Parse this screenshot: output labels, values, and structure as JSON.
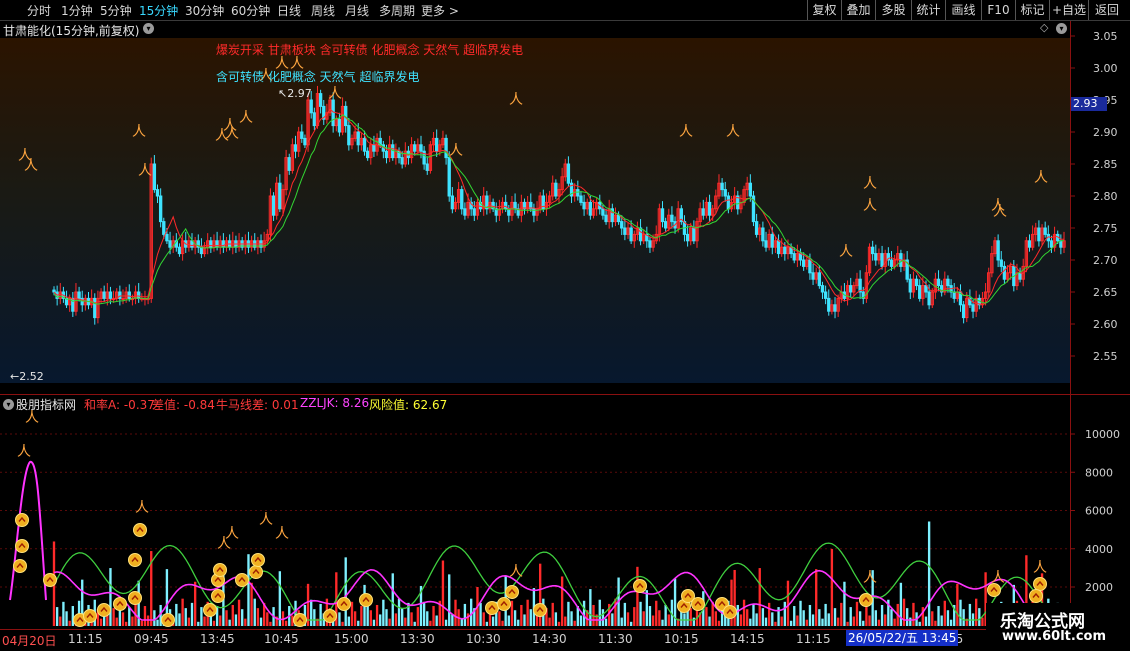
{
  "toolbar": {
    "periods": [
      "分时",
      "1分钟",
      "5分钟",
      "15分钟",
      "30分钟",
      "60分钟",
      "日线",
      "周线",
      "月线",
      "多周期",
      "更多 >"
    ],
    "active_period": "15分钟",
    "right_buttons": [
      "复权",
      "叠加",
      "多股",
      "统计",
      "画线",
      "F10",
      "标记",
      "+自选",
      "返回"
    ]
  },
  "main_chart": {
    "title": "甘肃能化(15分钟,前复权)",
    "news_line1": "爆炭开采 甘肃板块 含可转债 化肥概念 天然气 超临界发电",
    "news_line2": "含可转债 化肥概念 天然气 超临界发电",
    "y_ticks": [
      "3.05",
      "3.00",
      "2.95",
      "2.90",
      "2.85",
      "2.80",
      "2.75",
      "2.70",
      "2.65",
      "2.60",
      "2.55"
    ],
    "current_price": "2.93",
    "high_label": "2.97",
    "low_label": "2.52",
    "colors": {
      "up": "#ff2a2a",
      "down": "#3fe3ff",
      "ma_red": "#ff2a2a",
      "ma_green": "#33d633",
      "bg_top": "#2b1400",
      "bg_bottom": "#07182e"
    }
  },
  "indicator": {
    "name": "股朋指标网",
    "values": [
      {
        "text": "和率A: -0.37",
        "color": "#ff3a3a"
      },
      {
        "text": "差值: -0.84",
        "color": "#ff3a3a"
      },
      {
        "text": "牛马线差: 0.01",
        "color": "#ff3a3a"
      },
      {
        "text": "ZZLJK: 8.26",
        "color": "#ff44ff"
      },
      {
        "text": "风险值: 62.67",
        "color": "#ffff33"
      }
    ],
    "y_ticks": [
      "10000",
      "8000",
      "6000",
      "4000",
      "2000"
    ]
  },
  "time_axis": {
    "labels": [
      "04月20日",
      "11:15",
      "09:45",
      "13:45",
      "10:45",
      "15:00",
      "13:30",
      "10:30",
      "14:30",
      "11:30",
      "10:15",
      "14:15",
      "11:15",
      "13:45",
      "45"
    ],
    "cursor_time": "26/05/22/五 13:45"
  },
  "watermark": {
    "line1": "乐淘公式网",
    "line2": "www.60lt.com"
  },
  "chart_data": {
    "type": "candlestick",
    "title": "甘肃能化(15分钟,前复权)",
    "ylim": [
      2.52,
      3.07
    ],
    "close": [
      2.65,
      2.64,
      2.65,
      2.64,
      2.63,
      2.64,
      2.62,
      2.65,
      2.64,
      2.63,
      2.64,
      2.63,
      2.64,
      2.61,
      2.64,
      2.65,
      2.64,
      2.65,
      2.64,
      2.64,
      2.65,
      2.64,
      2.64,
      2.65,
      2.64,
      2.64,
      2.65,
      2.64,
      2.64,
      2.64,
      2.64,
      2.85,
      2.81,
      2.8,
      2.76,
      2.74,
      2.73,
      2.72,
      2.73,
      2.72,
      2.71,
      2.73,
      2.72,
      2.73,
      2.72,
      2.73,
      2.72,
      2.71,
      2.72,
      2.73,
      2.72,
      2.73,
      2.72,
      2.73,
      2.72,
      2.73,
      2.72,
      2.73,
      2.72,
      2.73,
      2.72,
      2.73,
      2.72,
      2.73,
      2.72,
      2.73,
      2.72,
      2.73,
      2.74,
      2.8,
      2.77,
      2.82,
      2.78,
      2.81,
      2.86,
      2.84,
      2.88,
      2.87,
      2.9,
      2.89,
      2.88,
      2.95,
      2.93,
      2.91,
      2.96,
      2.94,
      2.92,
      2.93,
      2.95,
      2.91,
      2.92,
      2.9,
      2.94,
      2.91,
      2.88,
      2.89,
      2.9,
      2.88,
      2.89,
      2.87,
      2.86,
      2.88,
      2.87,
      2.89,
      2.88,
      2.87,
      2.86,
      2.88,
      2.86,
      2.87,
      2.86,
      2.85,
      2.87,
      2.86,
      2.88,
      2.87,
      2.88,
      2.87,
      2.85,
      2.84,
      2.88,
      2.89,
      2.87,
      2.88,
      2.89,
      2.86,
      2.8,
      2.78,
      2.79,
      2.81,
      2.78,
      2.77,
      2.79,
      2.78,
      2.77,
      2.79,
      2.78,
      2.8,
      2.78,
      2.79,
      2.78,
      2.77,
      2.78,
      2.79,
      2.78,
      2.77,
      2.79,
      2.78,
      2.77,
      2.79,
      2.78,
      2.79,
      2.78,
      2.77,
      2.78,
      2.8,
      2.78,
      2.79,
      2.8,
      2.82,
      2.8,
      2.81,
      2.83,
      2.85,
      2.82,
      2.8,
      2.81,
      2.8,
      2.79,
      2.78,
      2.79,
      2.77,
      2.78,
      2.79,
      2.78,
      2.77,
      2.76,
      2.78,
      2.76,
      2.77,
      2.76,
      2.75,
      2.74,
      2.75,
      2.73,
      2.74,
      2.75,
      2.73,
      2.74,
      2.73,
      2.72,
      2.73,
      2.74,
      2.78,
      2.76,
      2.75,
      2.77,
      2.76,
      2.75,
      2.78,
      2.76,
      2.74,
      2.73,
      2.75,
      2.73,
      2.76,
      2.78,
      2.77,
      2.79,
      2.77,
      2.78,
      2.8,
      2.82,
      2.81,
      2.8,
      2.78,
      2.79,
      2.8,
      2.78,
      2.79,
      2.81,
      2.82,
      2.8,
      2.76,
      2.74,
      2.75,
      2.73,
      2.72,
      2.74,
      2.72,
      2.73,
      2.71,
      2.72,
      2.71,
      2.72,
      2.71,
      2.7,
      2.71,
      2.7,
      2.69,
      2.7,
      2.68,
      2.67,
      2.68,
      2.66,
      2.65,
      2.64,
      2.62,
      2.63,
      2.62,
      2.64,
      2.65,
      2.64,
      2.66,
      2.65,
      2.66,
      2.67,
      2.65,
      2.64,
      2.68,
      2.72,
      2.71,
      2.7,
      2.71,
      2.69,
      2.71,
      2.7,
      2.69,
      2.7,
      2.71,
      2.69,
      2.7,
      2.67,
      2.65,
      2.67,
      2.66,
      2.64,
      2.66,
      2.65,
      2.63,
      2.65,
      2.67,
      2.66,
      2.65,
      2.67,
      2.66,
      2.65,
      2.64,
      2.65,
      2.63,
      2.61,
      2.64,
      2.63,
      2.62,
      2.64,
      2.63,
      2.64,
      2.65,
      2.68,
      2.71,
      2.73,
      2.7,
      2.69,
      2.67,
      2.68,
      2.69,
      2.66,
      2.68,
      2.67,
      2.69,
      2.73,
      2.72,
      2.74,
      2.75,
      2.73,
      2.75,
      2.74,
      2.73,
      2.72,
      2.74,
      2.73,
      2.72,
      2.73
    ]
  }
}
